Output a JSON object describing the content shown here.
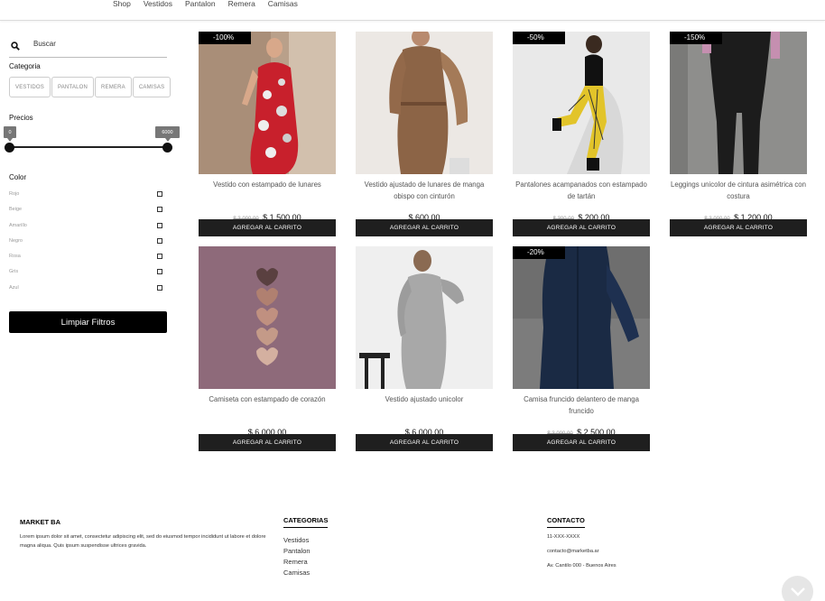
{
  "nav": {
    "items": [
      "Shop",
      "Vestidos",
      "Pantalon",
      "Remera",
      "Camisas"
    ]
  },
  "sidebar": {
    "search": {
      "placeholder": "Buscar",
      "icon": "search-icon"
    },
    "category_label": "Categoria",
    "categories": [
      "VESTIDOS",
      "PANTALON",
      "REMERA",
      "CAMISAS"
    ],
    "price_label": "Precios",
    "price_min": "0",
    "price_max": "6000",
    "color_label": "Color",
    "colors": [
      "Rojo",
      "Beige",
      "Amarillo",
      "Negro",
      "Rosa",
      "Gris",
      "Azul"
    ],
    "clear_button": "Limpiar Filtros"
  },
  "products": [
    {
      "badge": "-100%",
      "name": "Vestido con estampado de lunares",
      "old_price": "$ 3.000,00",
      "price": "$ 1.500,00",
      "cart": "AGREGAR AL CARRITO"
    },
    {
      "badge": "",
      "name": "Vestido ajustado de lunares de manga obispo con cinturón",
      "old_price": "",
      "price": "$ 600,00",
      "cart": "AGREGAR AL CARRITO"
    },
    {
      "badge": "-50%",
      "name": "Pantalones acampanados con estampado de tartán",
      "old_price": "$ 300,00",
      "price": "$ 200,00",
      "cart": "AGREGAR AL CARRITO"
    },
    {
      "badge": "-150%",
      "name": "Leggings unicolor de cintura asimétrica con costura",
      "old_price": "$ 3.000,00",
      "price": "$ 1.200,00",
      "cart": "AGREGAR AL CARRITO"
    },
    {
      "badge": "",
      "name": "Camiseta con estampado de corazón",
      "old_price": "",
      "price": "$ 6.000,00",
      "cart": "AGREGAR AL CARRITO"
    },
    {
      "badge": "",
      "name": "Vestido ajustado unicolor",
      "old_price": "",
      "price": "$ 6.000,00",
      "cart": "AGREGAR AL CARRITO"
    },
    {
      "badge": "-20%",
      "name": "Camisa fruncido delantero de manga fruncido",
      "old_price": "$ 3.000,00",
      "price": "$ 2.500,00",
      "cart": "AGREGAR AL CARRITO"
    }
  ],
  "footer": {
    "brand": "MARKET BA",
    "text": "Lorem ipsum dolor sit amet, consectetur adipiscing elit, sed do eiusmod tempor incididunt ut labore et dolore magna aliqua. Quis ipsum suspendisse ultrices gravida.",
    "categories_title": "CATEGORIAS",
    "categories": [
      "Vestidos",
      "Pantalon",
      "Remera",
      "Camisas"
    ],
    "contact_title": "CONTACTO",
    "contact": [
      "11-XXX-XXXX",
      "contacto@marketba.ar",
      "Av. Cantilo 000 - Buenos Aires"
    ]
  }
}
